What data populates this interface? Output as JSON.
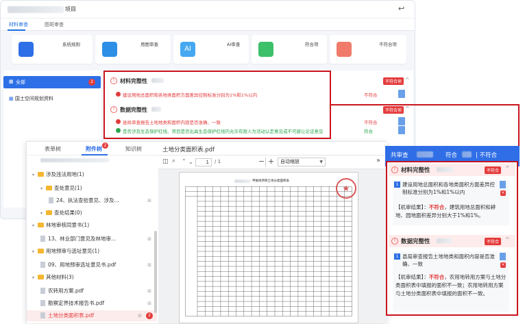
{
  "back": {
    "project_suffix": "项目",
    "tabs": [
      "材料审查",
      "图斑审查"
    ],
    "cards": [
      "系统规则",
      "用图审查",
      "AI审查",
      "符合项",
      "不符合项"
    ],
    "sidebar": {
      "all_label": "全部",
      "all_count": "2",
      "item2": "国土空间规划资料"
    },
    "sections": [
      {
        "title": "材料完整性",
        "tag": "不符合项",
        "items": [
          {
            "text": "建设用地总面积和各地类面积方面差异控制标准分别为1%和1%以内",
            "status": "不符合"
          }
        ]
      },
      {
        "title": "数据完整性",
        "tag": "不符合项",
        "items": [
          {
            "text": "县局审查报告土地地类和面积内容是否准确、一致",
            "status": "不符合"
          },
          {
            "text": "是否涉及生态保护红线、项目是否出具生态保护红线内允许有限人为活动认定意见或不可避让论证意见",
            "status": "符合"
          }
        ]
      }
    ]
  },
  "front": {
    "tabs": {
      "t1": "表单树",
      "t2": "附件树",
      "t2_badge": "2",
      "t3": "知识树"
    },
    "tree": [
      {
        "label": "涉及违法用地(1)",
        "type": "folder",
        "level": 0
      },
      {
        "label": "查处意见(1)",
        "type": "folder",
        "level": 1
      },
      {
        "label": "24、执法查验意见、涉及...",
        "type": "doc",
        "level": 2
      },
      {
        "label": "查处结果(0)",
        "type": "folder",
        "level": 1
      },
      {
        "label": "林地审核同意书(1)",
        "type": "folder",
        "level": 0
      },
      {
        "label": "13、林业部门意见及林地审...",
        "type": "doc",
        "level": 1
      },
      {
        "label": "用地预审与选址意见(1)",
        "type": "folder",
        "level": 0
      },
      {
        "label": "09、用地预审选址意见书.pdf",
        "type": "doc",
        "level": 1
      },
      {
        "label": "其他材料(3)",
        "type": "folder",
        "level": 0
      },
      {
        "label": "农转用方案.pdf",
        "type": "doc",
        "level": 1
      },
      {
        "label": "勘察定界技术报告书.pdf",
        "type": "doc",
        "level": 1
      },
      {
        "label": "土地分类面积表.pdf",
        "type": "doc",
        "level": 1,
        "selected": true,
        "badge": "2"
      }
    ],
    "viewer": {
      "title": "土地分类面积表.pdf",
      "page_current": "1",
      "page_total": "/ 1",
      "zoom": "自动缩放",
      "doc_heading": "申报地项目土地分类面积表"
    },
    "right": {
      "header": "共审查",
      "header_suffix": "符合",
      "header_suffix2": "| 不符合",
      "sections": [
        {
          "title": "材料完整性",
          "tag": "不符合",
          "num": "1",
          "text": "建设用地总面积和各地类面积方面差异控制标准分别为1%和1%以内",
          "result_label": "【机审结果】：",
          "result_status": "不符合",
          "result_text": "，建筑用地总面积和耕地、园地面积差异分别大于1%和1%。"
        },
        {
          "title": "数据完整性",
          "tag": "不符合",
          "num": "1",
          "text": "县局审查报告土地地类和面积内容是否准确、一致",
          "result_label": "【机审结果】：",
          "result_status": "不符合",
          "result_text": "，农用地转用方案与土地分类面积表中填报的面积不一致；农用地转用方案与土地分类面积表中填报的面积不一致。"
        }
      ]
    }
  },
  "colors": {
    "accent": "#2f6ee6",
    "danger": "#e43b3b",
    "ok": "#2aa54a",
    "highlight": "#c9141d"
  }
}
